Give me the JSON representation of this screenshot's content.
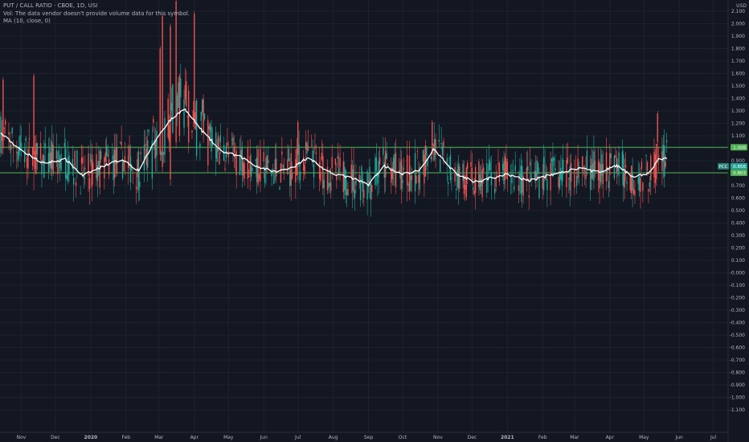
{
  "legend": {
    "title": "PUT / CALL RATIO · CBOE, 1D, USI",
    "volume_note": "Vol: The data vendor doesn't provide volume data for this symbol.",
    "ma_label": "MA (10, close, 0)"
  },
  "price_axis": {
    "currency": "USD",
    "ticks": [
      "2.100",
      "2.000",
      "1.900",
      "1.800",
      "1.700",
      "1.600",
      "1.500",
      "1.400",
      "1.300",
      "1.200",
      "1.100",
      "1.000",
      "0.900",
      "0.800",
      "0.700",
      "0.600",
      "0.500",
      "0.400",
      "0.300",
      "0.200",
      "0.100",
      "-0.000",
      "-0.100",
      "-0.200",
      "-0.300",
      "-0.400",
      "-0.500",
      "-0.600",
      "-0.700",
      "-0.800",
      "-0.900",
      "-1.000",
      "-1.100"
    ]
  },
  "time_axis": {
    "labels": [
      "Nov",
      "Dec",
      "2020",
      "Feb",
      "Mar",
      "Apr",
      "May",
      "Jun",
      "Jul",
      "Aug",
      "Sep",
      "Oct",
      "Nov",
      "Dec",
      "2021",
      "Feb",
      "Mar",
      "Apr",
      "May",
      "Jun",
      "Jul"
    ]
  },
  "horizontal_lines": [
    {
      "value": 1.008,
      "label": "1.008",
      "color": "#4caf50"
    },
    {
      "value": 0.803,
      "label": "0.803",
      "color": "#4caf50"
    }
  ],
  "tags": {
    "series_name": "PCC",
    "series_value": "0.856"
  },
  "colors": {
    "background": "#131722",
    "grid": "#1e222d",
    "up": "#26a69a",
    "down": "#ef5350",
    "ma": "#ffffff",
    "hline": "#4caf50",
    "axis_text": "#b2b5be"
  },
  "chart_data": {
    "type": "candlestick",
    "title": "PUT / CALL RATIO · CBOE, 1D, USI",
    "y_range": [
      -1.1,
      2.1
    ],
    "x_start": "2019-10-14",
    "x_end": "2021-07-09",
    "last_bar": "2021-05-21",
    "hlines": [
      1.008,
      0.803
    ],
    "ma_anchors": [
      [
        "2019-10-14",
        1.12
      ],
      [
        "2019-10-31",
        0.99
      ],
      [
        "2019-11-20",
        0.88
      ],
      [
        "2019-12-10",
        0.91
      ],
      [
        "2019-12-25",
        0.78
      ],
      [
        "2020-01-15",
        0.87
      ],
      [
        "2020-01-29",
        0.91
      ],
      [
        "2020-02-12",
        0.82
      ],
      [
        "2020-02-26",
        1.05
      ],
      [
        "2020-03-09",
        1.21
      ],
      [
        "2020-03-23",
        1.32
      ],
      [
        "2020-04-08",
        1.14
      ],
      [
        "2020-04-24",
        0.98
      ],
      [
        "2020-05-12",
        0.93
      ],
      [
        "2020-05-27",
        0.85
      ],
      [
        "2020-06-12",
        0.81
      ],
      [
        "2020-06-29",
        0.86
      ],
      [
        "2020-07-10",
        0.93
      ],
      [
        "2020-07-27",
        0.81
      ],
      [
        "2020-08-17",
        0.76
      ],
      [
        "2020-09-01",
        0.71
      ],
      [
        "2020-09-15",
        0.86
      ],
      [
        "2020-09-30",
        0.79
      ],
      [
        "2020-10-16",
        0.82
      ],
      [
        "2020-10-28",
        0.99
      ],
      [
        "2020-11-18",
        0.79
      ],
      [
        "2020-12-03",
        0.73
      ],
      [
        "2020-12-31",
        0.79
      ],
      [
        "2021-01-20",
        0.74
      ],
      [
        "2021-02-10",
        0.79
      ],
      [
        "2021-03-05",
        0.84
      ],
      [
        "2021-03-22",
        0.81
      ],
      [
        "2021-04-07",
        0.86
      ],
      [
        "2021-04-22",
        0.77
      ],
      [
        "2021-05-05",
        0.8
      ],
      [
        "2021-05-14",
        0.91
      ],
      [
        "2021-05-21",
        0.92
      ]
    ],
    "spikes": [
      [
        "2019-10-16",
        1.57,
        1.0
      ],
      [
        "2019-11-12",
        1.6,
        0.95
      ],
      [
        "2020-03-02",
        1.82,
        0.95
      ],
      [
        "2020-03-04",
        2.08,
        0.85
      ],
      [
        "2020-03-11",
        2.0,
        0.75
      ],
      [
        "2020-03-16",
        2.2,
        1.05
      ],
      [
        "2020-03-19",
        1.6,
        1.1
      ],
      [
        "2020-04-01",
        2.1,
        1.2
      ],
      [
        "2020-07-01",
        1.23,
        0.95
      ],
      [
        "2020-10-27",
        1.23,
        0.95
      ],
      [
        "2021-05-13",
        1.3,
        1.05
      ]
    ]
  }
}
